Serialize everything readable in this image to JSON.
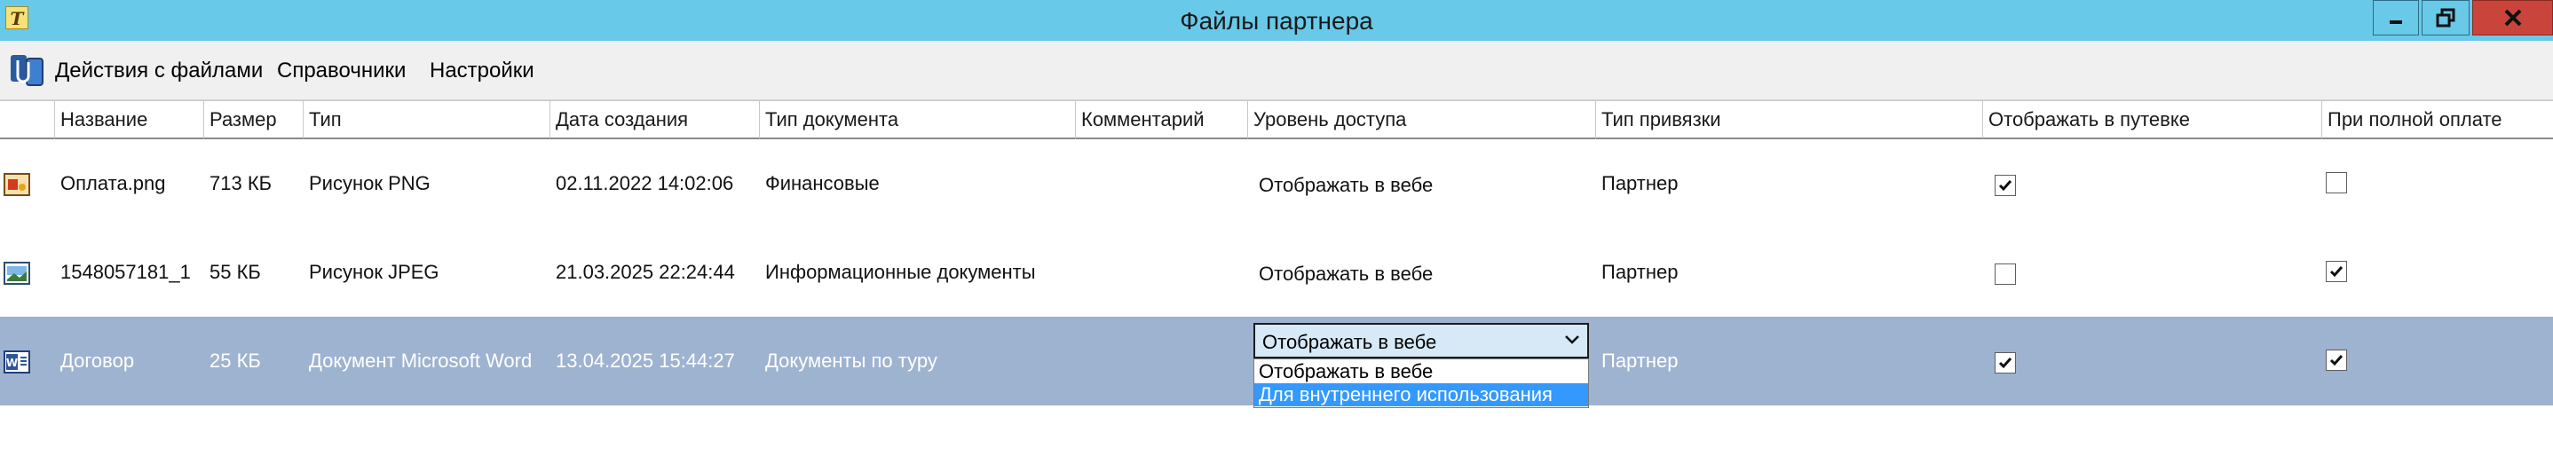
{
  "window": {
    "title": "Файлы партнера",
    "app_icon_glyph": "T",
    "buttons": {
      "minimize": "minimize-icon",
      "maximize": "maximize-icon",
      "close": "close-icon"
    }
  },
  "menu": {
    "logo_icon": "files-app-icon",
    "items": [
      "Действия с файлами",
      "Справочники",
      "Настройки"
    ]
  },
  "grid": {
    "columns": [
      "Название",
      "Размер",
      "Тип",
      "Дата создания",
      "Тип документа",
      "Комментарий",
      "Уровень доступа",
      "Тип привязки",
      "Отображать в путевке",
      "При полной оплате"
    ],
    "rows": [
      {
        "icon": "png-file-icon",
        "name": "Оплата.png",
        "size": "713 КБ",
        "type": "Рисунок PNG",
        "created": "02.11.2022 14:02:06",
        "doc_type": "Финансовые",
        "comment": "",
        "access": "Отображать в вебе",
        "binding": "Партнер",
        "show_in_voucher": true,
        "full_payment": false,
        "selected": false
      },
      {
        "icon": "jpeg-file-icon",
        "name": "1548057181_1",
        "size": "55 КБ",
        "type": "Рисунок JPEG",
        "created": "21.03.2025 22:24:44",
        "doc_type": "Информационные документы",
        "comment": "",
        "access": "Отображать в вебе",
        "binding": "Партнер",
        "show_in_voucher": false,
        "full_payment": true,
        "selected": false
      },
      {
        "icon": "word-file-icon",
        "name": "Договор",
        "size": "25 КБ",
        "type": "Документ Microsoft Word",
        "created": "13.04.2025 15:44:27",
        "doc_type": "Документы по туру",
        "comment": "",
        "access": "Отображать в вебе",
        "binding": "Партнер",
        "show_in_voucher": true,
        "full_payment": true,
        "selected": true
      }
    ]
  },
  "access_dropdown": {
    "value": "Отображать в вебе",
    "options": [
      "Отображать в вебе",
      "Для внутреннего использования"
    ],
    "highlighted_option": "Для внутреннего использования"
  },
  "colors": {
    "titlebar": "#69c9e8",
    "close_button": "#c9443a",
    "selected_row": "#9eb3d0",
    "dropdown_highlight": "#3399ff",
    "combo_background": "#d5e9f7"
  }
}
